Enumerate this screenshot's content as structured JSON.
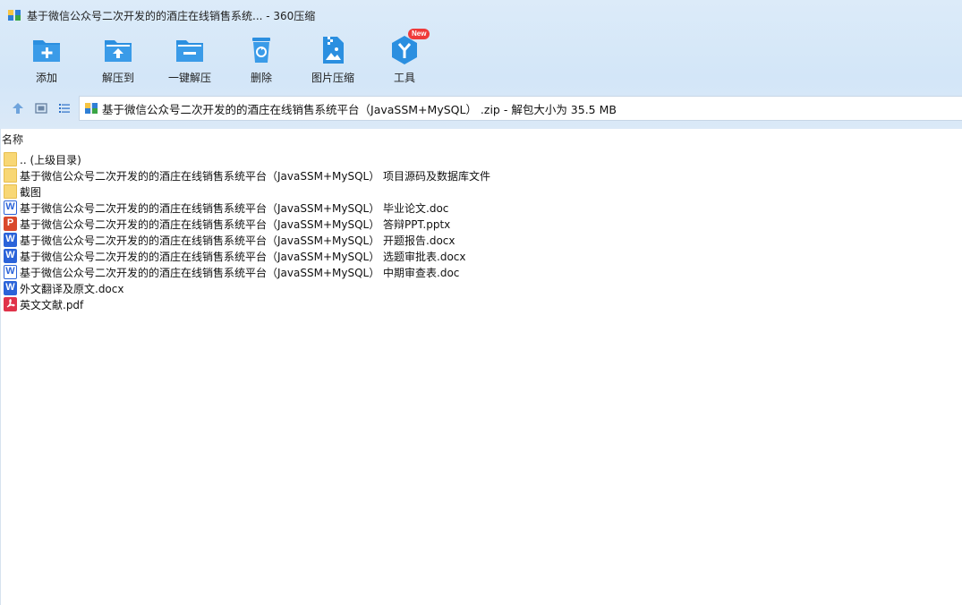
{
  "window": {
    "title": "基于微信公众号二次开发的的酒庄在线销售系统... - 360压缩"
  },
  "toolbar": {
    "items": [
      {
        "label": "添加",
        "icon": "folder-add-icon"
      },
      {
        "label": "解压到",
        "icon": "folder-extract-icon"
      },
      {
        "label": "一键解压",
        "icon": "one-click-extract-icon"
      },
      {
        "label": "删除",
        "icon": "recycle-bin-icon"
      },
      {
        "label": "图片压缩",
        "icon": "image-compress-icon"
      },
      {
        "label": "工具",
        "icon": "tools-icon",
        "badge": "New"
      }
    ]
  },
  "address": {
    "path": "基于微信公众号二次开发的的酒庄在线销售系统平台（JavaSSM+MySQL） .zip - 解包大小为 35.5 MB"
  },
  "list": {
    "column_name": "名称",
    "files": [
      {
        "name": ".. (上级目录)",
        "type": "folder"
      },
      {
        "name": "基于微信公众号二次开发的的酒庄在线销售系统平台（JavaSSM+MySQL） 项目源码及数据库文件",
        "type": "folder"
      },
      {
        "name": "截图",
        "type": "folder"
      },
      {
        "name": "基于微信公众号二次开发的的酒庄在线销售系统平台（JavaSSM+MySQL） 毕业论文.doc",
        "type": "doc"
      },
      {
        "name": "基于微信公众号二次开发的的酒庄在线销售系统平台（JavaSSM+MySQL） 答辩PPT.pptx",
        "type": "pptx"
      },
      {
        "name": "基于微信公众号二次开发的的酒庄在线销售系统平台（JavaSSM+MySQL） 开题报告.docx",
        "type": "docx"
      },
      {
        "name": "基于微信公众号二次开发的的酒庄在线销售系统平台（JavaSSM+MySQL） 选题审批表.docx",
        "type": "docx"
      },
      {
        "name": "基于微信公众号二次开发的的酒庄在线销售系统平台（JavaSSM+MySQL） 中期审查表.doc",
        "type": "doc"
      },
      {
        "name": "外文翻译及原文.docx",
        "type": "docx"
      },
      {
        "name": "英文文献.pdf",
        "type": "pdf"
      }
    ]
  },
  "colors": {
    "accent": "#2b8fe0",
    "toolbar_bg": "#d3e6f8"
  }
}
